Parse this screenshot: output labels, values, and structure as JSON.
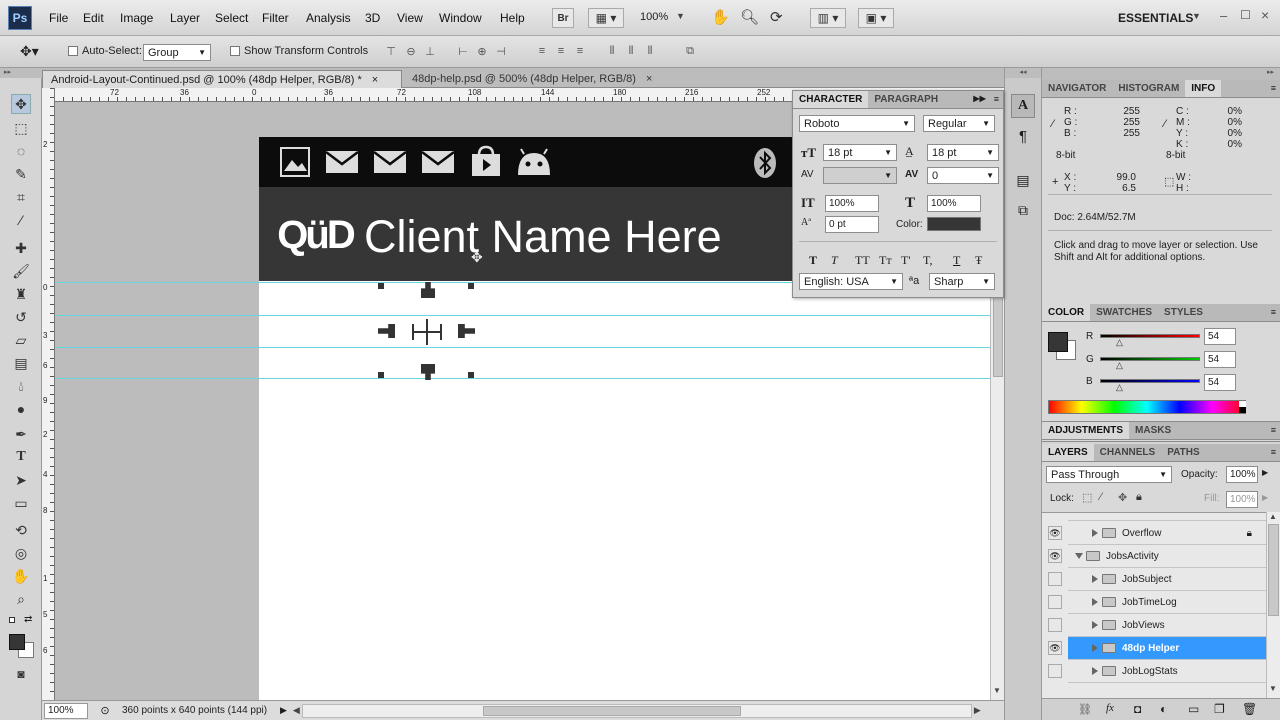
{
  "app": {
    "logo": "Ps"
  },
  "menu": [
    "File",
    "Edit",
    "Image",
    "Layer",
    "Select",
    "Filter",
    "Analysis",
    "3D",
    "View",
    "Window",
    "Help"
  ],
  "appbar": {
    "bridge": "Br",
    "zoom": "100%",
    "workspace": "ESSENTIALS"
  },
  "options": {
    "auto_select_label": "Auto-Select:",
    "auto_select_value": "Group",
    "transform_label": "Show Transform Controls"
  },
  "tabs": [
    {
      "title": "Android-Layout-Continued.psd @ 100% (48dp Helper, RGB/8) *"
    },
    {
      "title": "48dp-help.psd @ 500% (48dp Helper, RGB/8)"
    }
  ],
  "ruler": {
    "h": [
      "72",
      "36",
      "0",
      "36",
      "72",
      "108",
      "144",
      "180",
      "216",
      "252"
    ],
    "v": [
      "2",
      "0",
      "3",
      "6",
      "9",
      "2",
      "4",
      "8",
      "1",
      "5",
      "6"
    ]
  },
  "canvas": {
    "client_name": "Client Name Here",
    "brand": "QüD"
  },
  "status": {
    "zoom": "100%",
    "info": "360 points x 640 points (144 ppi)"
  },
  "character": {
    "tabs": [
      "CHARACTER",
      "PARAGRAPH"
    ],
    "font": "Roboto",
    "style": "Regular",
    "size": "18 pt",
    "leading": "18 pt",
    "kerning": "",
    "tracking": "0",
    "vscale": "100%",
    "hscale": "100%",
    "baseline": "0 pt",
    "color_label": "Color:",
    "language": "English: USA",
    "antialias": "Sharp",
    "styles": [
      "T",
      "T",
      "TT",
      "Tт",
      "T'",
      "T,",
      "T",
      "Ŧ"
    ]
  },
  "info": {
    "tabs": [
      "NAVIGATOR",
      "HISTOGRAM",
      "INFO"
    ],
    "rgb": [
      {
        "k": "R :",
        "v": "255"
      },
      {
        "k": "G :",
        "v": "255"
      },
      {
        "k": "B :",
        "v": "255"
      }
    ],
    "cmyk": [
      {
        "k": "C :",
        "v": "0%"
      },
      {
        "k": "M :",
        "v": "0%"
      },
      {
        "k": "Y :",
        "v": "0%"
      },
      {
        "k": "K :",
        "v": "0%"
      }
    ],
    "bit1": "8-bit",
    "bit2": "8-bit",
    "x": "X :",
    "x_val": "99.0",
    "y": "Y :",
    "y_val": "6.5",
    "w": "W :",
    "h": "H :",
    "doc": "Doc: 2.64M/52.7M",
    "hint": "Click and drag to move layer or selection.  Use Shift and Alt for additional options."
  },
  "color": {
    "tabs": [
      "COLOR",
      "SWATCHES",
      "STYLES"
    ],
    "channels": [
      {
        "k": "R",
        "v": "54"
      },
      {
        "k": "G",
        "v": "54"
      },
      {
        "k": "B",
        "v": "54"
      }
    ],
    "fg": "#363636"
  },
  "adjust": {
    "tabs": [
      "ADJUSTMENTS",
      "MASKS"
    ]
  },
  "layers": {
    "tabs": [
      "LAYERS",
      "CHANNELS",
      "PATHS"
    ],
    "blend": "Pass Through",
    "opacity_label": "Opacity:",
    "opacity": "100%",
    "lock_label": "Lock:",
    "fill_label": "Fill:",
    "fill": "100%",
    "items": [
      {
        "name": "Overflow",
        "eye": true,
        "indent": 1,
        "locked": true,
        "selected": false
      },
      {
        "name": "JobsActivity",
        "eye": true,
        "indent": 0,
        "locked": false,
        "selected": false,
        "open": true
      },
      {
        "name": "JobSubject",
        "eye": false,
        "indent": 1,
        "locked": false,
        "selected": false
      },
      {
        "name": "JobTimeLog",
        "eye": false,
        "indent": 1,
        "locked": false,
        "selected": false
      },
      {
        "name": "JobViews",
        "eye": false,
        "indent": 1,
        "locked": false,
        "selected": false
      },
      {
        "name": "48dp Helper",
        "eye": true,
        "indent": 1,
        "locked": false,
        "selected": true
      },
      {
        "name": "JobLogStats",
        "eye": false,
        "indent": 1,
        "locked": false,
        "selected": false
      }
    ]
  },
  "colors": {
    "accent": "#3399ff",
    "guide": "#66d7de",
    "brand_orange": "#f4a23a"
  }
}
